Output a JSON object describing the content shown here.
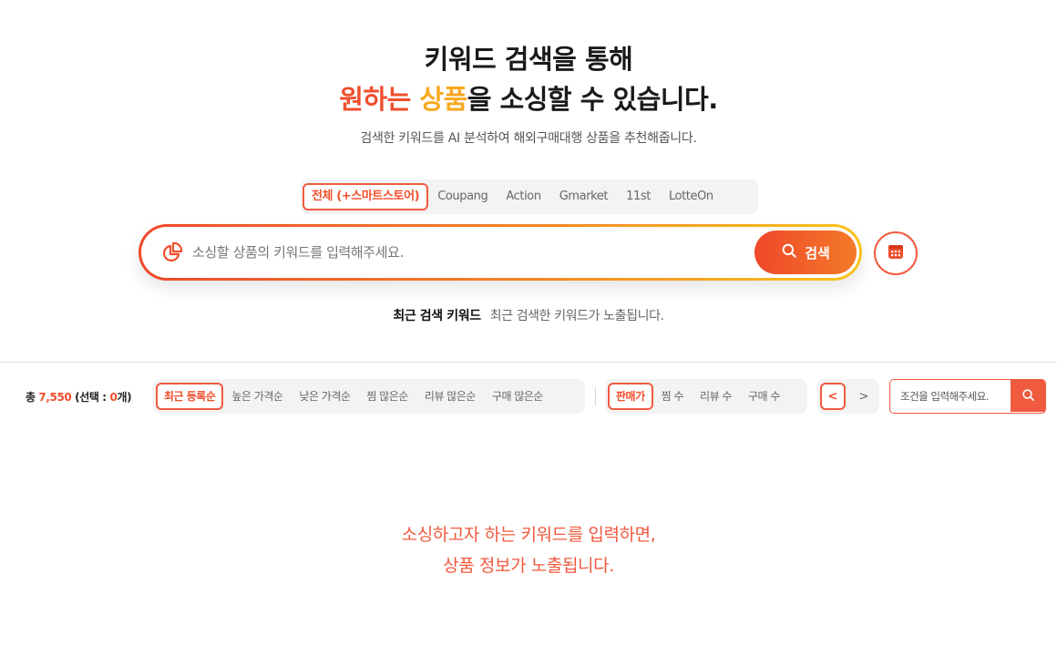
{
  "hero": {
    "title_line1": "키워드 검색을 통해",
    "title_line2_red": "원하는 ",
    "title_line2_orange": "상품",
    "title_line2_rest": "을 소싱할 수 있습니다.",
    "subtitle": "검색한 키워드를 AI 분석하여 해외구매대행 상품을 추천해줍니다."
  },
  "platform_tabs": [
    {
      "label": "전체 (+스마트스토어)",
      "active": true
    },
    {
      "label": "Coupang",
      "active": false
    },
    {
      "label": "Action",
      "active": false
    },
    {
      "label": "Gmarket",
      "active": false
    },
    {
      "label": "11st",
      "active": false
    },
    {
      "label": "LotteOn",
      "active": false
    }
  ],
  "search": {
    "placeholder": "소싱할 상품의 키워드를 입력해주세요.",
    "button_label": "검색"
  },
  "recent": {
    "label": "최근 검색 키워드",
    "description": "최근 검색한 키워드가 노출됩니다."
  },
  "toolbar": {
    "total_prefix": "총 ",
    "total_count": "7,550",
    "selected_prefix": " (선택 : ",
    "selected_count": "0",
    "selected_suffix": "개)",
    "sort_options": [
      {
        "label": "최근 등록순",
        "active": true
      },
      {
        "label": "높은 가격순",
        "active": false
      },
      {
        "label": "낮은 가격순",
        "active": false
      },
      {
        "label": "찜 많은순",
        "active": false
      },
      {
        "label": "리뷰 많은순",
        "active": false
      },
      {
        "label": "구매 많은순",
        "active": false
      }
    ],
    "metric_options": [
      {
        "label": "판매가",
        "active": true
      },
      {
        "label": "찜 수",
        "active": false
      },
      {
        "label": "리뷰 수",
        "active": false
      },
      {
        "label": "구매 수",
        "active": false
      }
    ],
    "prev_label": "<",
    "next_label": ">",
    "filter_placeholder": "조건을 입력해주세요."
  },
  "empty_state": {
    "line1": "소싱하고자 하는 키워드를 입력하면,",
    "line2": "상품 정보가 노출됩니다."
  },
  "colors": {
    "accent": "#f05a3f",
    "accent_red": "#f04e2d",
    "accent_orange": "#f7a91e"
  }
}
